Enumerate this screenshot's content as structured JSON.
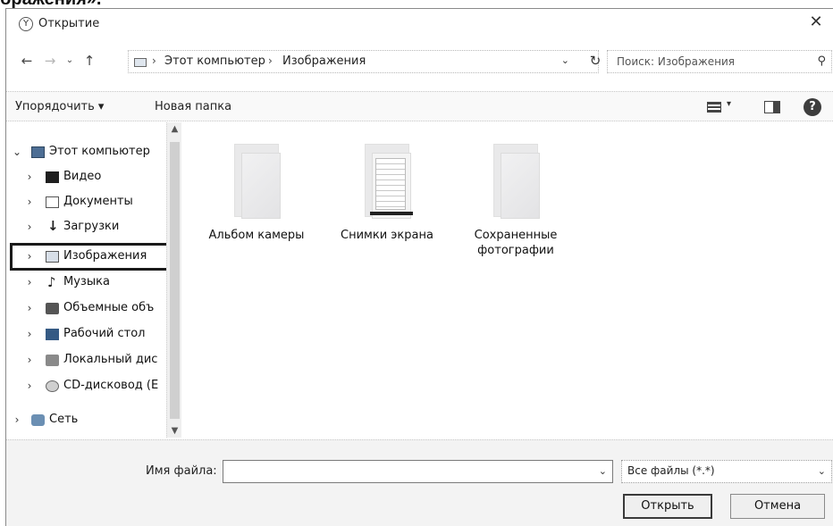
{
  "document": {
    "heading_fragment": "бражения»."
  },
  "window": {
    "title": "Открытие",
    "close_glyph": "✕"
  },
  "navigation": {
    "back": "←",
    "forward": "→",
    "recent": "⌄",
    "up": "↑"
  },
  "address": {
    "crumbs": [
      "Этот компьютер",
      "Изображения"
    ],
    "separator": "›",
    "dropdown": "⌄",
    "refresh": "↻"
  },
  "search": {
    "placeholder": "Поиск: Изображения"
  },
  "toolbar": {
    "arrange_label": "Упорядочить ▾",
    "new_folder_label": "Новая папка",
    "view_dropdown": "▾",
    "help": "?"
  },
  "nav_tree": {
    "items": [
      {
        "label": "Этот компьютер",
        "chevron": "⌄",
        "icon": "pc-icon"
      },
      {
        "label": "Видео",
        "chevron": "›",
        "icon": "video-icon"
      },
      {
        "label": "Документы",
        "chevron": "›",
        "icon": "documents-icon"
      },
      {
        "label": "Загрузки",
        "chevron": "›",
        "icon": "downloads-icon"
      },
      {
        "label": "Изображения",
        "chevron": "›",
        "icon": "pictures-icon",
        "selected": true
      },
      {
        "label": "Музыка",
        "chevron": "›",
        "icon": "music-icon"
      },
      {
        "label": "Объемные объ",
        "chevron": "›",
        "icon": "3d-objects-icon"
      },
      {
        "label": "Рабочий стол",
        "chevron": "›",
        "icon": "desktop-icon"
      },
      {
        "label": "Локальный дис",
        "chevron": "›",
        "icon": "local-disk-icon"
      },
      {
        "label": "CD-дисковод (E",
        "chevron": "›",
        "icon": "cd-drive-icon"
      },
      {
        "label": "Сеть",
        "chevron": "›",
        "icon": "network-icon"
      }
    ],
    "scroll_up": "▲",
    "scroll_down": "▼"
  },
  "folders": [
    {
      "line1": "Альбом камеры",
      "line2": ""
    },
    {
      "line1": "Снимки экрана",
      "line2": ""
    },
    {
      "line1": "Сохраненные",
      "line2": "фотографии"
    }
  ],
  "footer": {
    "filename_label": "Имя файла:",
    "filename_value": "",
    "filename_dropdown": "⌄",
    "filter_value": "Все файлы (*.*)",
    "filter_dropdown": "⌄",
    "open_button": "Открыть",
    "cancel_button": "Отмена"
  }
}
